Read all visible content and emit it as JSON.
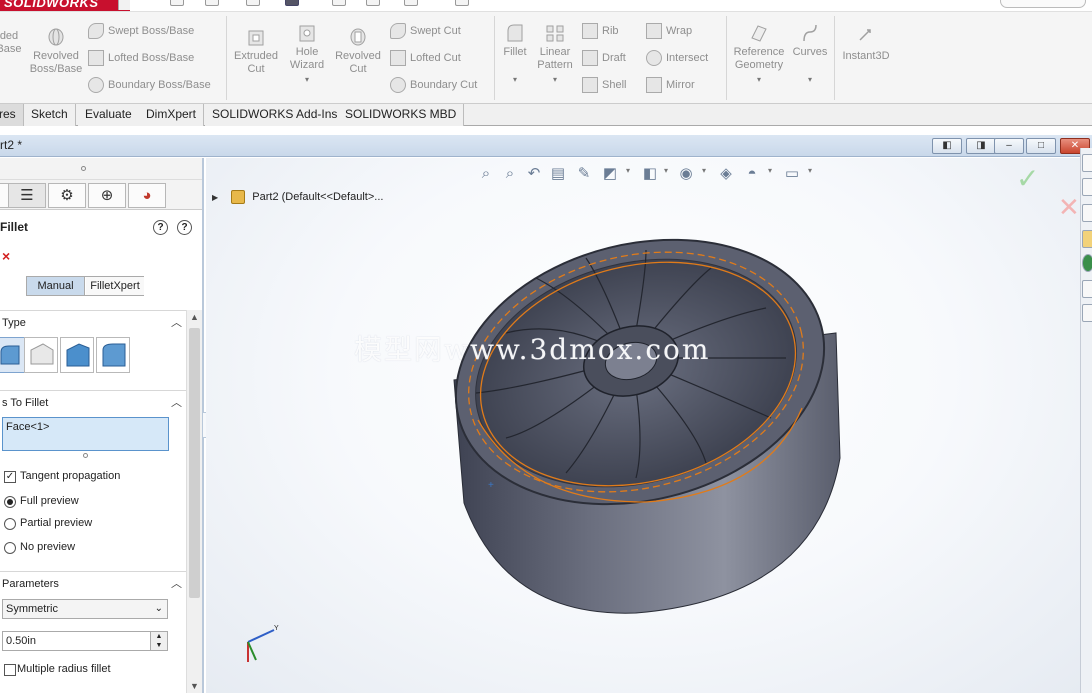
{
  "app": {
    "logo": "SOLIDWORKS"
  },
  "ribbon": {
    "extruded_base": {
      "line1": "ded",
      "line2": "Base"
    },
    "revolved_base": {
      "line1": "Revolved",
      "line2": "Boss/Base"
    },
    "swept_boss": "Swept Boss/Base",
    "lofted_boss": "Lofted Boss/Base",
    "boundary_boss": "Boundary Boss/Base",
    "extruded_cut": {
      "line1": "Extruded",
      "line2": "Cut"
    },
    "hole_wizard": {
      "line1": "Hole",
      "line2": "Wizard"
    },
    "revolved_cut": {
      "line1": "Revolved",
      "line2": "Cut"
    },
    "swept_cut": "Swept Cut",
    "lofted_cut": "Lofted Cut",
    "boundary_cut": "Boundary Cut",
    "fillet": "Fillet",
    "linear_pattern": {
      "line1": "Linear",
      "line2": "Pattern"
    },
    "rib": "Rib",
    "draft": "Draft",
    "shell": "Shell",
    "wrap": "Wrap",
    "intersect": "Intersect",
    "mirror": "Mirror",
    "reference_geometry": {
      "line1": "Reference",
      "line2": "Geometry"
    },
    "curves": "Curves",
    "instant3d": "Instant3D"
  },
  "tabs": [
    "res",
    "Sketch",
    "Evaluate",
    "DimXpert",
    "SOLIDWORKS Add-Ins",
    "SOLIDWORKS MBD"
  ],
  "document": {
    "title": "rt2 *"
  },
  "window_buttons": {
    "close": "✕"
  },
  "property_manager": {
    "title": "Fillet",
    "help1": "?",
    "help2": "?",
    "cancel": "×",
    "mode_manual": "Manual",
    "mode_xpert": "FilletXpert",
    "section_type": "Type",
    "section_items": "s To Fillet",
    "face_item": "Face<1>",
    "tangent_propagation": "Tangent propagation",
    "full_preview": "Full preview",
    "partial_preview": "Partial preview",
    "no_preview": "No preview",
    "section_parameters": "Parameters",
    "method_value": "Symmetric",
    "radius_value": "0.50in",
    "multiple_radius": "Multiple radius fillet"
  },
  "graphics": {
    "tree_root": "Part2  (Default<<Default>...",
    "watermark": "模型网www.3dmox.com"
  },
  "colors": {
    "brand_red": "#c8102e",
    "part_body": "#5f6373",
    "preview_orange": "#e07b1a",
    "selected_blue": "#d6e8f8"
  }
}
